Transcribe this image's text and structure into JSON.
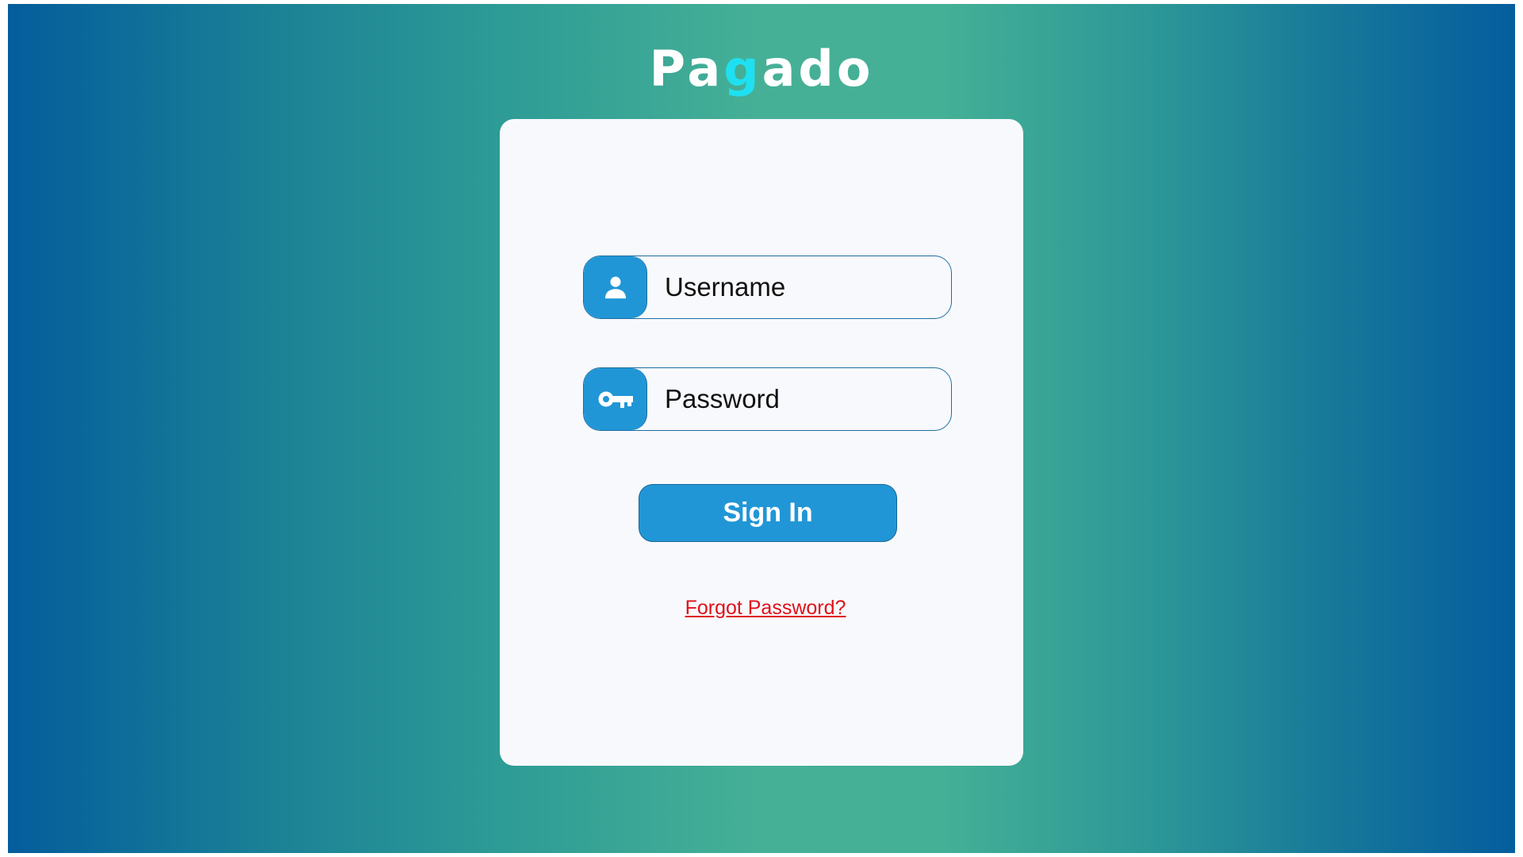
{
  "brand": {
    "logo_part1": "Pa",
    "logo_accent": "g",
    "logo_part2": "ado",
    "accent_color": "#1fe0f0"
  },
  "login_form": {
    "username": {
      "placeholder": "Username",
      "value": "",
      "icon": "user-icon"
    },
    "password": {
      "placeholder": "Password",
      "value": "",
      "icon": "key-icon"
    },
    "sign_in_label": "Sign In",
    "forgot_password_label": "Forgot Password?"
  },
  "colors": {
    "primary_button": "#2196d6",
    "link": "#e0101a",
    "card_background": "#f8f9fc"
  }
}
